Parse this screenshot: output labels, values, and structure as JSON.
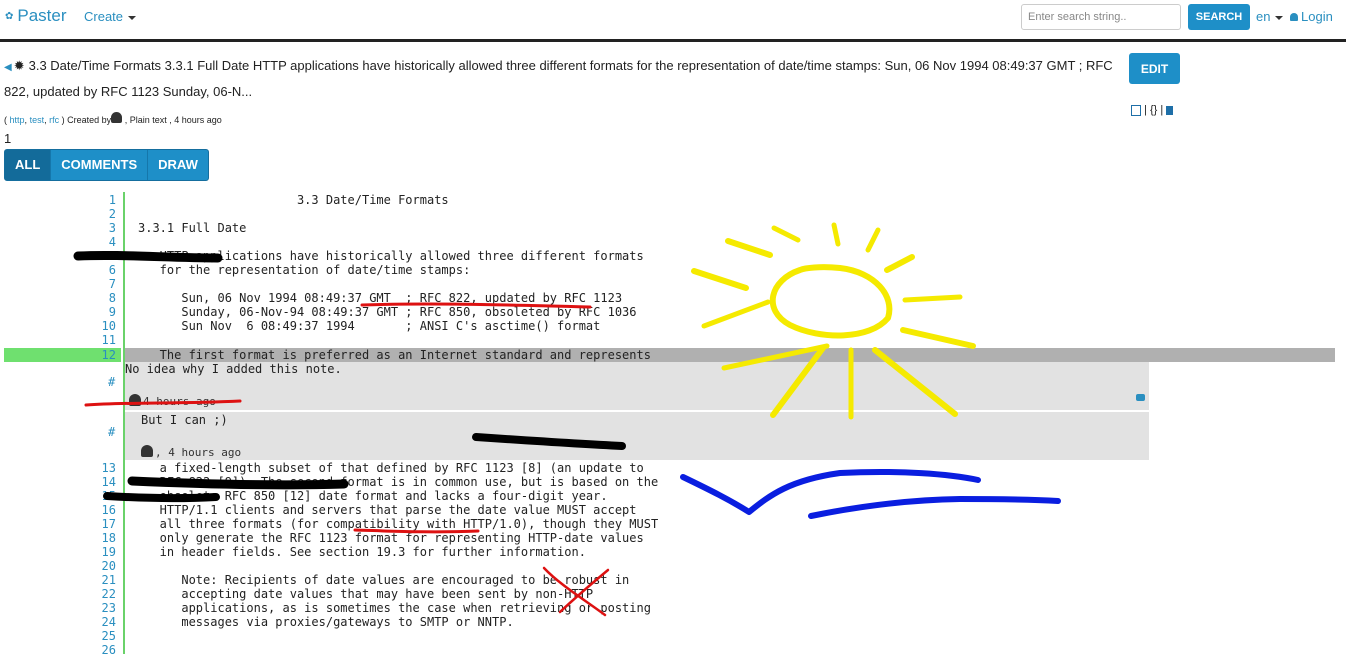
{
  "nav": {
    "brand": "Paster",
    "create": "Create",
    "search_placeholder": "Enter search string..",
    "search_button": "SEARCH",
    "language": "en",
    "login": "Login"
  },
  "paste": {
    "title": "3.3 Date/Time Formats 3.3.1 Full Date HTTP applications have historically allowed three different formats for the representation of date/time stamps: Sun, 06 Nov 1994 08:49:37 GMT ; RFC 822, updated by RFC 1123 Sunday, 06-N...",
    "edit_button": "EDIT",
    "actions": {
      "sep1": "|",
      "json": "{}",
      "sep2": "|"
    },
    "meta": {
      "open": "(",
      "tags": [
        "http",
        "test",
        "rfc"
      ],
      "sep": ",",
      "close": ")",
      "created_by": "Created by",
      "type_time": ", Plain text , 4 hours ago"
    },
    "count": "1",
    "tabs": [
      "ALL",
      "COMMENTS",
      "DRAW"
    ]
  },
  "lines": [
    {
      "n": "1",
      "t": "                      3.3 Date/Time Formats"
    },
    {
      "n": "2",
      "t": ""
    },
    {
      "n": "3",
      "t": "3.3.1 Full Date"
    },
    {
      "n": "4",
      "t": ""
    },
    {
      "n": "5",
      "t": "   HTTP applications have historically allowed three different formats"
    },
    {
      "n": "6",
      "t": "   for the representation of date/time stamps:"
    },
    {
      "n": "7",
      "t": ""
    },
    {
      "n": "8",
      "t": "      Sun, 06 Nov 1994 08:49:37 GMT  ; RFC 822, updated by RFC 1123"
    },
    {
      "n": "9",
      "t": "      Sunday, 06-Nov-94 08:49:37 GMT ; RFC 850, obsoleted by RFC 1036"
    },
    {
      "n": "10",
      "t": "      Sun Nov  6 08:49:37 1994       ; ANSI C's asctime() format"
    },
    {
      "n": "11",
      "t": ""
    },
    {
      "n": "12",
      "t": "   The first format is preferred as an Internet standard and represents"
    },
    {
      "n": "13",
      "t": "   a fixed-length subset of that defined by RFC 1123 [8] (an update to"
    },
    {
      "n": "14",
      "t": "   RFC 822 [9]). The second format is in common use, but is based on the"
    },
    {
      "n": "15",
      "t": "   obsolete RFC 850 [12] date format and lacks a four-digit year."
    },
    {
      "n": "16",
      "t": "   HTTP/1.1 clients and servers that parse the date value MUST accept"
    },
    {
      "n": "17",
      "t": "   all three formats (for compatibility with HTTP/1.0), though they MUST"
    },
    {
      "n": "18",
      "t": "   only generate the RFC 1123 format for representing HTTP-date values"
    },
    {
      "n": "19",
      "t": "   in header fields. See section 19.3 for further information."
    },
    {
      "n": "20",
      "t": ""
    },
    {
      "n": "21",
      "t": "      Note: Recipients of date values are encouraged to be robust in"
    },
    {
      "n": "22",
      "t": "      accepting date values that may have been sent by non-HTTP"
    },
    {
      "n": "23",
      "t": "      applications, as is sometimes the case when retrieving or posting"
    },
    {
      "n": "24",
      "t": "      messages via proxies/gateways to SMTP or NNTP."
    },
    {
      "n": "25",
      "t": ""
    },
    {
      "n": "26",
      "t": ""
    }
  ],
  "comments": [
    {
      "hash": "#",
      "text": "No idea why I added this note.",
      "meta": "4 hours ago"
    },
    {
      "hash": "#",
      "text": "But I can ;)",
      "meta": ", 4 hours ago"
    }
  ],
  "colors": {
    "accent": "#1e8fc8",
    "highlight_gutter": "#6fe06f",
    "highlight_line": "#b0b0b0",
    "comment_bg": "#e2e2e2",
    "draw_black": "#000000",
    "draw_red": "#dd1111",
    "draw_yellow": "#f5ea00",
    "draw_blue": "#0a1ee0"
  },
  "icons": [
    "paster-logo-icon",
    "caret-down-icon",
    "user-icon",
    "back-arrow-icon",
    "bug-icon",
    "calendar-icon",
    "file-icon",
    "comment-icon"
  ]
}
